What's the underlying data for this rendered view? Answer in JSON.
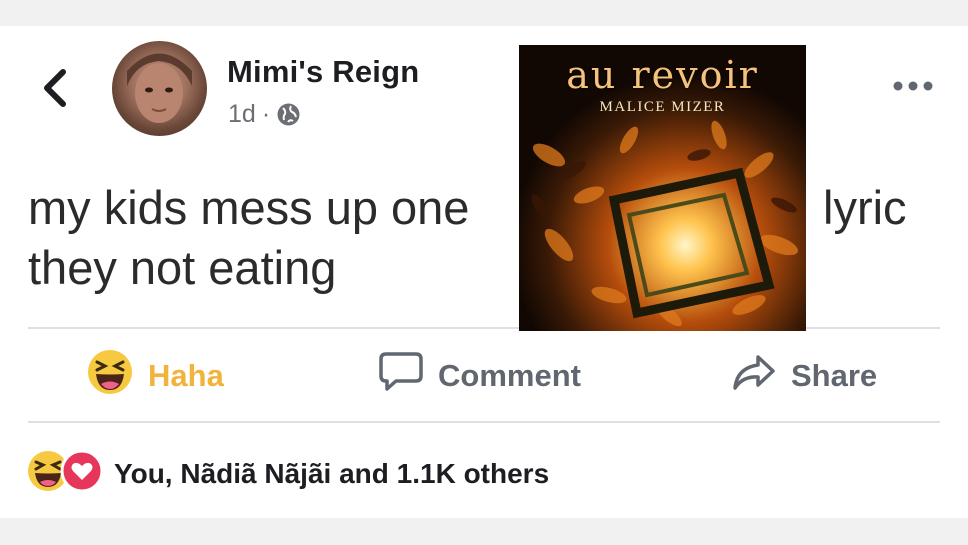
{
  "post": {
    "author": "Mimi's Reign",
    "time": "1d",
    "separator": "·",
    "text_line1": "my kids mess up one",
    "text_line1_end": "lyric",
    "text_line2": "they not eating"
  },
  "actions": {
    "haha": "Haha",
    "comment": "Comment",
    "share": "Share"
  },
  "reactions": {
    "summary": "You, Nãdiã Nãjãi and 1.1K others"
  },
  "album": {
    "title": "au revoir",
    "artist": "MALICE MIZER"
  },
  "icons": {
    "back": "chevron-left-icon",
    "privacy": "globe-icon",
    "more": "more-options-icon",
    "haha": "haha-emoji-icon",
    "comment": "comment-icon",
    "share": "share-icon",
    "love": "love-reaction-icon"
  },
  "colors": {
    "haha": "#f2b33d",
    "action_gray": "#606770",
    "love": "#e6375a"
  }
}
